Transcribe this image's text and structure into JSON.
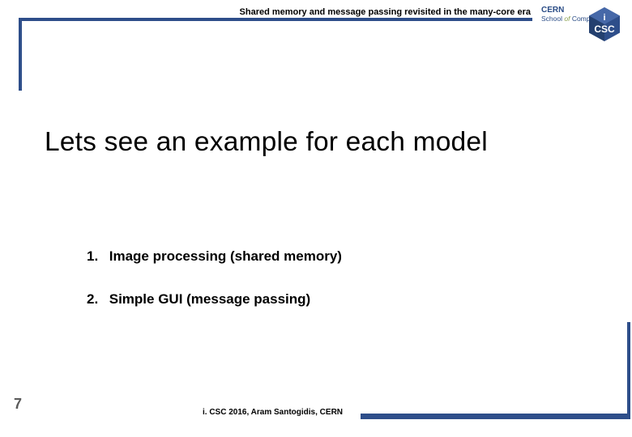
{
  "header": {
    "subtitle": "Shared memory and message passing revisited in the many-core era"
  },
  "logo": {
    "line1": "CERN",
    "line2_pre": "School ",
    "line2_of": "of",
    "line2_post": " Computing",
    "badge_top": "i",
    "badge_bottom": "CSC"
  },
  "main": {
    "title": "Lets see an example for each model"
  },
  "list": {
    "items": [
      {
        "num": "1.",
        "text": "Image processing (shared memory)"
      },
      {
        "num": "2.",
        "text": "Simple GUI (message passing)"
      }
    ]
  },
  "footer": {
    "page": "7",
    "text": "i. CSC 2016, Aram Santogidis, CERN"
  }
}
